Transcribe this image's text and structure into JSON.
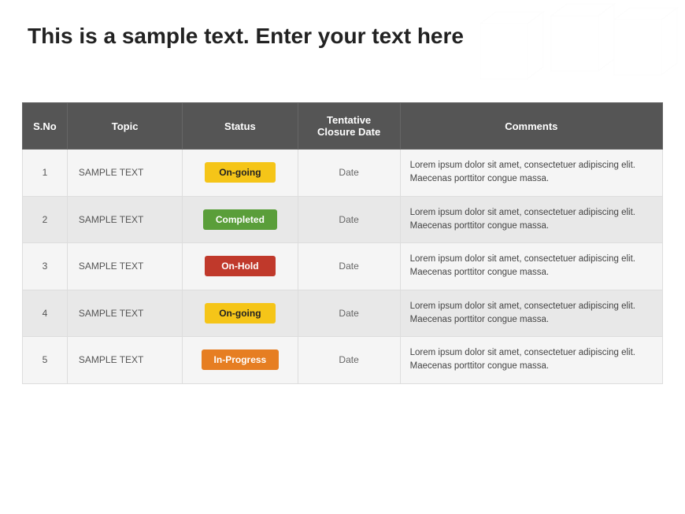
{
  "title": "This is a sample text. Enter your text here",
  "table": {
    "headers": [
      "S.No",
      "Topic",
      "Status",
      "Tentative Closure Date",
      "Comments"
    ],
    "rows": [
      {
        "sno": "1",
        "topic": "SAMPLE TEXT",
        "status": "On-going",
        "status_type": "ongoing",
        "date": "Date",
        "comments": "Lorem ipsum dolor sit amet, consectetuer adipiscing elit. Maecenas porttitor congue massa."
      },
      {
        "sno": "2",
        "topic": "SAMPLE TEXT",
        "status": "Completed",
        "status_type": "completed",
        "date": "Date",
        "comments": "Lorem ipsum dolor sit amet, consectetuer adipiscing elit. Maecenas porttitor congue massa."
      },
      {
        "sno": "3",
        "topic": "SAMPLE TEXT",
        "status": "On-Hold",
        "status_type": "onhold",
        "date": "Date",
        "comments": "Lorem ipsum dolor sit amet, consectetuer adipiscing elit. Maecenas porttitor congue massa."
      },
      {
        "sno": "4",
        "topic": "SAMPLE TEXT",
        "status": "On-going",
        "status_type": "ongoing",
        "date": "Date",
        "comments": "Lorem ipsum dolor sit amet, consectetuer adipiscing elit. Maecenas porttitor congue massa."
      },
      {
        "sno": "5",
        "topic": "SAMPLE TEXT",
        "status": "In-Progress",
        "status_type": "inprogress",
        "date": "Date",
        "comments": "Lorem ipsum dolor sit amet, consectetuer adipiscing elit. Maecenas porttitor congue massa."
      }
    ]
  },
  "colors": {
    "header_bg": "#555555",
    "ongoing": "#F5C518",
    "completed": "#5a9e3a",
    "onhold": "#c0392b",
    "inprogress": "#e67e22"
  }
}
